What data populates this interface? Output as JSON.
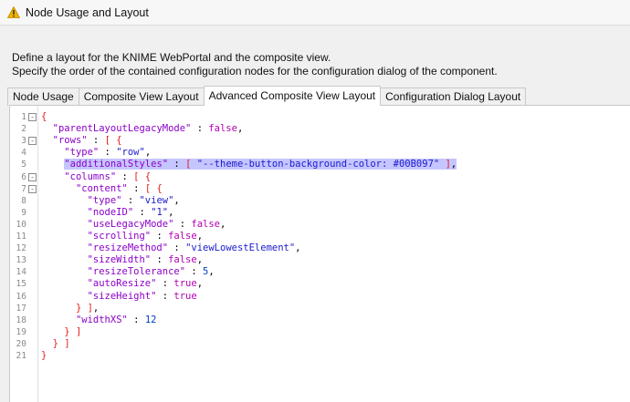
{
  "window": {
    "title": "Node Usage and Layout",
    "warning_icon": "warning-triangle-icon"
  },
  "description": {
    "line1": "Define a layout for the KNIME WebPortal and the composite view.",
    "line2": "Specify the order of the contained configuration nodes for the configuration dialog of the component."
  },
  "tabs": [
    {
      "label": "Node Usage",
      "active": false
    },
    {
      "label": "Composite View Layout",
      "active": false
    },
    {
      "label": "Advanced Composite View Layout",
      "active": true
    },
    {
      "label": "Configuration Dialog Layout",
      "active": false
    }
  ],
  "editor": {
    "lines": [
      {
        "n": "1",
        "fold": "-",
        "tokens": [
          [
            "p",
            "{"
          ]
        ]
      },
      {
        "n": "2",
        "fold": "",
        "tokens": [
          [
            "t",
            "  "
          ],
          [
            "k",
            "\"parentLayoutLegacyMode\""
          ],
          [
            "t",
            " : "
          ],
          [
            "b",
            "false"
          ],
          [
            "t",
            ","
          ]
        ]
      },
      {
        "n": "3",
        "fold": "-",
        "tokens": [
          [
            "t",
            "  "
          ],
          [
            "k",
            "\"rows\""
          ],
          [
            "t",
            " : "
          ],
          [
            "p",
            "["
          ],
          [
            "t",
            " "
          ],
          [
            "p",
            "{"
          ]
        ]
      },
      {
        "n": "4",
        "fold": "",
        "tokens": [
          [
            "t",
            "    "
          ],
          [
            "k",
            "\"type\""
          ],
          [
            "t",
            " : "
          ],
          [
            "s",
            "\"row\""
          ],
          [
            "t",
            ","
          ]
        ]
      },
      {
        "n": "5",
        "fold": "",
        "highlight": true,
        "tokens": [
          [
            "t",
            "    "
          ],
          [
            "k",
            "\"additionalStyles\""
          ],
          [
            "t",
            " : "
          ],
          [
            "p",
            "["
          ],
          [
            "t",
            " "
          ],
          [
            "s",
            "\"--theme-button-background-color: #00B097\""
          ],
          [
            "t",
            " "
          ],
          [
            "p",
            "]"
          ],
          [
            "t",
            ","
          ]
        ]
      },
      {
        "n": "6",
        "fold": "-",
        "tokens": [
          [
            "t",
            "    "
          ],
          [
            "k",
            "\"columns\""
          ],
          [
            "t",
            " : "
          ],
          [
            "p",
            "["
          ],
          [
            "t",
            " "
          ],
          [
            "p",
            "{"
          ]
        ]
      },
      {
        "n": "7",
        "fold": "-",
        "tokens": [
          [
            "t",
            "      "
          ],
          [
            "k",
            "\"content\""
          ],
          [
            "t",
            " : "
          ],
          [
            "p",
            "["
          ],
          [
            "t",
            " "
          ],
          [
            "p",
            "{"
          ]
        ]
      },
      {
        "n": "8",
        "fold": "",
        "tokens": [
          [
            "t",
            "        "
          ],
          [
            "k",
            "\"type\""
          ],
          [
            "t",
            " : "
          ],
          [
            "s",
            "\"view\""
          ],
          [
            "t",
            ","
          ]
        ]
      },
      {
        "n": "9",
        "fold": "",
        "tokens": [
          [
            "t",
            "        "
          ],
          [
            "k",
            "\"nodeID\""
          ],
          [
            "t",
            " : "
          ],
          [
            "s",
            "\"1\""
          ],
          [
            "t",
            ","
          ]
        ]
      },
      {
        "n": "10",
        "fold": "",
        "tokens": [
          [
            "t",
            "        "
          ],
          [
            "k",
            "\"useLegacyMode\""
          ],
          [
            "t",
            " : "
          ],
          [
            "b",
            "false"
          ],
          [
            "t",
            ","
          ]
        ]
      },
      {
        "n": "11",
        "fold": "",
        "tokens": [
          [
            "t",
            "        "
          ],
          [
            "k",
            "\"scrolling\""
          ],
          [
            "t",
            " : "
          ],
          [
            "b",
            "false"
          ],
          [
            "t",
            ","
          ]
        ]
      },
      {
        "n": "12",
        "fold": "",
        "tokens": [
          [
            "t",
            "        "
          ],
          [
            "k",
            "\"resizeMethod\""
          ],
          [
            "t",
            " : "
          ],
          [
            "s",
            "\"viewLowestElement\""
          ],
          [
            "t",
            ","
          ]
        ]
      },
      {
        "n": "13",
        "fold": "",
        "tokens": [
          [
            "t",
            "        "
          ],
          [
            "k",
            "\"sizeWidth\""
          ],
          [
            "t",
            " : "
          ],
          [
            "b",
            "false"
          ],
          [
            "t",
            ","
          ]
        ]
      },
      {
        "n": "14",
        "fold": "",
        "tokens": [
          [
            "t",
            "        "
          ],
          [
            "k",
            "\"resizeTolerance\""
          ],
          [
            "t",
            " : "
          ],
          [
            "n",
            "5"
          ],
          [
            "t",
            ","
          ]
        ]
      },
      {
        "n": "15",
        "fold": "",
        "tokens": [
          [
            "t",
            "        "
          ],
          [
            "k",
            "\"autoResize\""
          ],
          [
            "t",
            " : "
          ],
          [
            "b",
            "true"
          ],
          [
            "t",
            ","
          ]
        ]
      },
      {
        "n": "16",
        "fold": "",
        "tokens": [
          [
            "t",
            "        "
          ],
          [
            "k",
            "\"sizeHeight\""
          ],
          [
            "t",
            " : "
          ],
          [
            "b",
            "true"
          ]
        ]
      },
      {
        "n": "17",
        "fold": "",
        "tokens": [
          [
            "t",
            "      "
          ],
          [
            "p",
            "}"
          ],
          [
            "t",
            " "
          ],
          [
            "p",
            "]"
          ],
          [
            "t",
            ","
          ]
        ]
      },
      {
        "n": "18",
        "fold": "",
        "tokens": [
          [
            "t",
            "      "
          ],
          [
            "k",
            "\"widthXS\""
          ],
          [
            "t",
            " : "
          ],
          [
            "n",
            "12"
          ]
        ]
      },
      {
        "n": "19",
        "fold": "",
        "tokens": [
          [
            "t",
            "    "
          ],
          [
            "p",
            "}"
          ],
          [
            "t",
            " "
          ],
          [
            "p",
            "]"
          ]
        ]
      },
      {
        "n": "20",
        "fold": "",
        "tokens": [
          [
            "t",
            "  "
          ],
          [
            "p",
            "}"
          ],
          [
            "t",
            " "
          ],
          [
            "p",
            "]"
          ]
        ]
      },
      {
        "n": "21",
        "fold": "",
        "tokens": [
          [
            "p",
            "}"
          ]
        ]
      }
    ]
  },
  "colors": {
    "highlight": "#c5c5ff",
    "key": "#8b00c8",
    "string": "#1a1acc",
    "bool": "#b000b0",
    "bracket": "#e02020",
    "number": "#0040c0",
    "warning": "#f0b400"
  }
}
